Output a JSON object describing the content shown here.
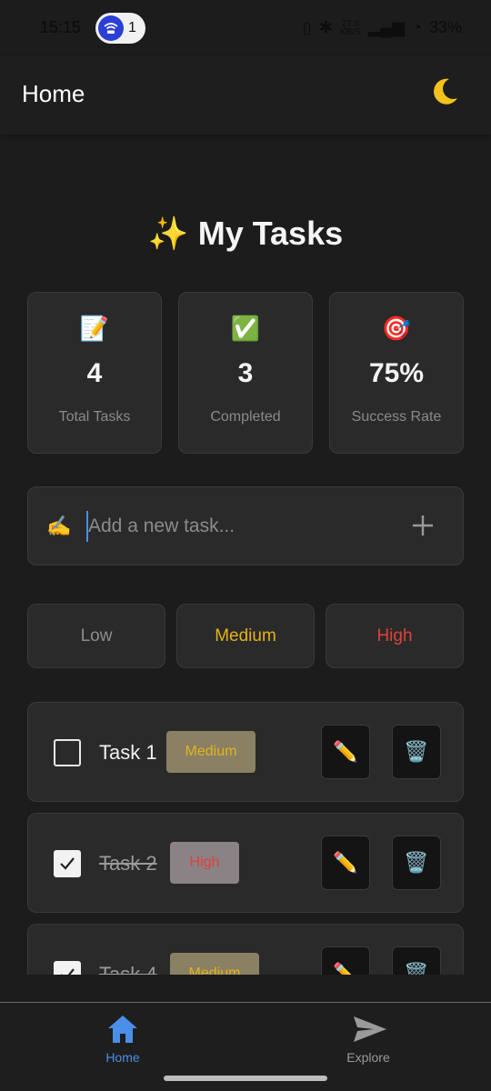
{
  "status_bar": {
    "time": "15:15",
    "notification_count": "1",
    "network_speed_value": "27.0",
    "network_speed_unit": "KB/S",
    "signal_label": "⁵ᴳ",
    "battery": "33%"
  },
  "app_bar": {
    "title": "Home",
    "theme_icon": "moon-icon"
  },
  "page": {
    "title_emoji": "✨",
    "title": "My Tasks"
  },
  "stats": [
    {
      "icon": "📝",
      "value": "4",
      "label": "Total Tasks"
    },
    {
      "icon": "✅",
      "value": "3",
      "label": "Completed"
    },
    {
      "icon": "🎯",
      "value": "75%",
      "label": "Success Rate"
    }
  ],
  "add_task": {
    "icon": "✍️",
    "placeholder": "Add a new task...",
    "value": ""
  },
  "priorities": [
    {
      "label": "Low",
      "color": "#8c8c8c"
    },
    {
      "label": "Medium",
      "color": "#e4b21a"
    },
    {
      "label": "High",
      "color": "#e0403a"
    }
  ],
  "tasks": [
    {
      "name": "Task 1",
      "priority": "Medium",
      "completed": false,
      "edit_icon": "✏️",
      "delete_icon": "🗑️"
    },
    {
      "name": "Task 2",
      "priority": "High",
      "completed": true,
      "edit_icon": "✏️",
      "delete_icon": "🗑️"
    },
    {
      "name": "Task 4",
      "priority": "Medium",
      "completed": true,
      "edit_icon": "✏️",
      "delete_icon": "🗑️"
    }
  ],
  "bottom_nav": {
    "items": [
      {
        "label": "Home",
        "icon": "home-icon",
        "active": true
      },
      {
        "label": "Explore",
        "icon": "send-icon",
        "active": false
      }
    ],
    "active_color": "#4a8fe8",
    "inactive_color": "#9a9a9a"
  }
}
